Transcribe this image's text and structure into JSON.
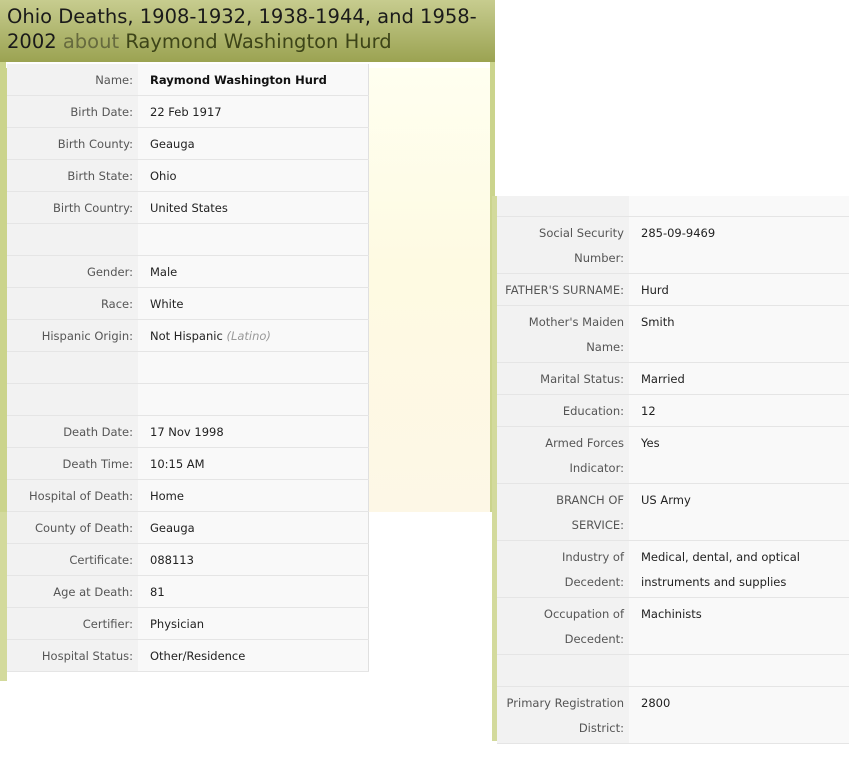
{
  "header": {
    "title_part1": "Ohio Deaths, 1908-1932, 1938-1944, and 1958-",
    "title_part2": "2002",
    "about": "about",
    "person": "Raymond Washington Hurd"
  },
  "left_fields": [
    {
      "label": "Name:",
      "value": "Raymond Washington Hurd"
    },
    {
      "label": "Birth Date:",
      "value": "22 Feb 1917"
    },
    {
      "label": "Birth County:",
      "value": "Geauga"
    },
    {
      "label": "Birth State:",
      "value": "Ohio"
    },
    {
      "label": "Birth Country:",
      "value": "United States"
    },
    {
      "label": "",
      "value": ""
    },
    {
      "label": "Gender:",
      "value": "Male"
    },
    {
      "label": "Race:",
      "value": "White"
    },
    {
      "label": "Hispanic Origin:",
      "value": "Not Hispanic",
      "note": "(Latino)"
    },
    {
      "label": "",
      "value": ""
    },
    {
      "label": "",
      "value": ""
    },
    {
      "label": "Death Date:",
      "value": "17 Nov 1998"
    },
    {
      "label": "Death Time:",
      "value": "10:15 AM"
    },
    {
      "label": "Hospital of Death:",
      "value": "Home"
    },
    {
      "label": "County of Death:",
      "value": "Geauga"
    },
    {
      "label": "Certificate:",
      "value": "088113"
    },
    {
      "label": "Age at Death:",
      "value": "81"
    },
    {
      "label": "Certifier:",
      "value": "Physician"
    },
    {
      "label": "Hospital Status:",
      "value": "Other/Residence"
    }
  ],
  "right_fields": [
    {
      "label": "Social Security Number:",
      "value": "285-09-9469"
    },
    {
      "label": "FATHER'S SURNAME:",
      "value": "Hurd"
    },
    {
      "label": "Mother's Maiden Name:",
      "value": "Smith"
    },
    {
      "label": "Marital Status:",
      "value": "Married"
    },
    {
      "label": "Education:",
      "value": "12"
    },
    {
      "label": "Armed Forces Indicator:",
      "value": "Yes"
    },
    {
      "label": "BRANCH OF SERVICE:",
      "value": "US Army"
    },
    {
      "label": "Industry of Decedent:",
      "value": "Medical, dental, and optical instruments and supplies"
    },
    {
      "label": "Occupation of Decedent:",
      "value": "Machinists"
    },
    {
      "label": "",
      "value": ""
    },
    {
      "label": "Primary Registration District:",
      "value": "2800"
    }
  ]
}
